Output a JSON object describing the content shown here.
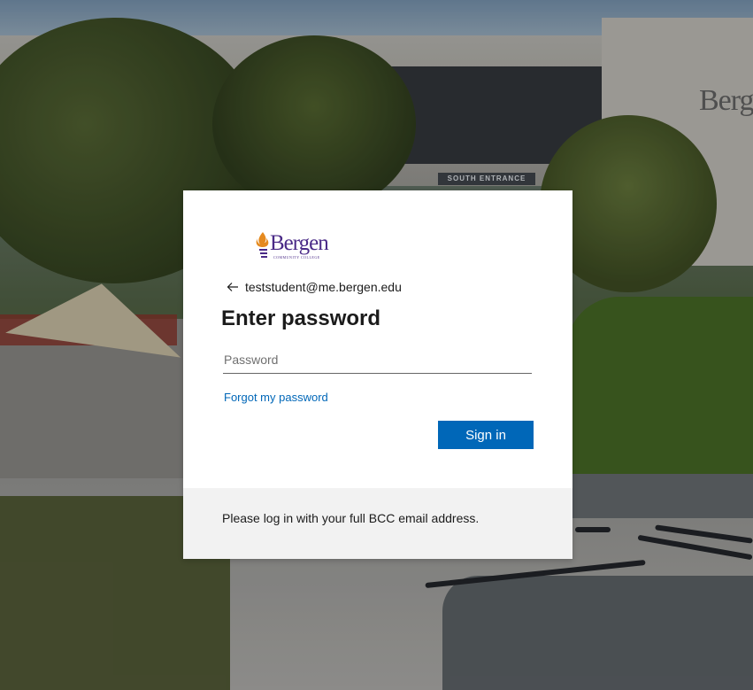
{
  "background": {
    "sign_text": "Berge",
    "entrance_text": "SOUTH ENTRANCE"
  },
  "logo": {
    "name": "Bergen",
    "subtitle": "COMMUNITY COLLEGE",
    "brand_color": "#4a2a87",
    "flame_color": "#e58a1f"
  },
  "identity": {
    "back_icon": "back-arrow-icon",
    "email": "teststudent@me.bergen.edu"
  },
  "title": "Enter password",
  "password": {
    "placeholder": "Password",
    "value": ""
  },
  "forgot_link": "Forgot my password",
  "signin_label": "Sign in",
  "footer_text": "Please log in with your full BCC email address.",
  "colors": {
    "accent": "#0067b8",
    "card_bg": "#ffffff",
    "footer_bg": "#f2f2f2"
  }
}
